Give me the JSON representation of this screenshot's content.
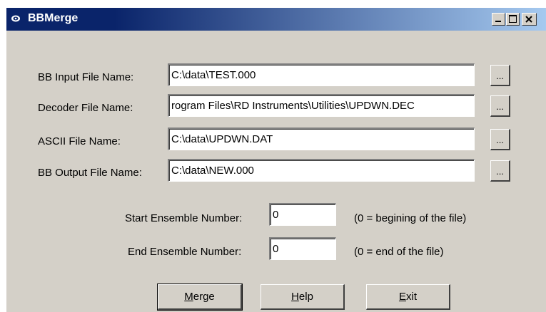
{
  "window": {
    "title": "BBMerge",
    "accent": "#0a246a"
  },
  "files": {
    "bb_input": {
      "label": "BB Input File Name:",
      "value": "C:\\data\\TEST.000",
      "browse": "..."
    },
    "decoder": {
      "label": "Decoder File Name:",
      "value": "rogram Files\\RD Instruments\\Utilities\\UPDWN.DEC",
      "browse": "..."
    },
    "ascii": {
      "label": "ASCII File Name:",
      "value": "C:\\data\\UPDWN.DAT",
      "browse": "..."
    },
    "bb_output": {
      "label": "BB Output File Name:",
      "value": "C:\\data\\NEW.000",
      "browse": "..."
    }
  },
  "ensemble": {
    "start_label": "Start Ensemble Number:",
    "start_value": "0",
    "start_hint": "(0 = begining of the file)",
    "end_label": "End Ensemble Number:",
    "end_value": "0",
    "end_hint": "(0 = end of the file)"
  },
  "buttons": {
    "merge_mnemonic": "M",
    "merge_rest": "erge",
    "help_mnemonic": "H",
    "help_rest": "elp",
    "exit_mnemonic": "E",
    "exit_rest": "xit"
  }
}
